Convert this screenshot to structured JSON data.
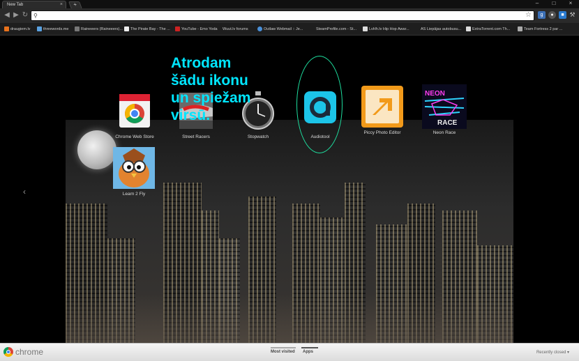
{
  "browser": {
    "tab_title": "New Tab",
    "tab_close": "×",
    "new_tab": "+",
    "window_controls": [
      "–",
      "□",
      "×"
    ],
    "omnibox_value": ""
  },
  "bookmarks": [
    "draugiem.lv",
    "threewords.me",
    "Raineeers (Raineeers)...",
    "The Pirate Bay - The ...",
    "YouTube - Emo Yoda",
    "Wuut.lv forums",
    "Outlaw Webmail :: Je...",
    "SteamProfile.com - St...",
    "LvHh.lv Hip Hop Awar...",
    "AS Liepājas autobusu...",
    "ExtraTorrent.com Th...",
    "Team Fortress 2 par ..."
  ],
  "apps": [
    {
      "label": "Chrome Web Store"
    },
    {
      "label": "Street Racers"
    },
    {
      "label": "Stopwatch"
    },
    {
      "label": "Audiotool"
    },
    {
      "label": "Piccy Photo Editor"
    },
    {
      "label": "Neon Race",
      "art_text": [
        "NEON",
        "RACE"
      ]
    },
    {
      "label": "Learn 2 Fly"
    }
  ],
  "annotation": {
    "line1": "Atrodam",
    "line2": "šādu ikonu",
    "line3": "un spiežam",
    "line4": "virsū."
  },
  "footer": {
    "brand": "chrome",
    "tab_most_visited": "Most visited",
    "tab_apps": "Apps",
    "recently_closed": "Recently closed ▾"
  }
}
